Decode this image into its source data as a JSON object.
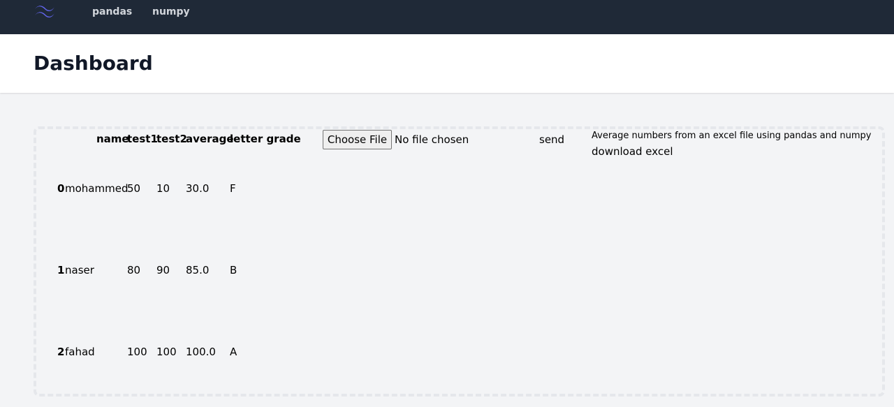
{
  "nav": {
    "logo_icon": "wave-logo-icon",
    "links": [
      "pandas",
      "numpy"
    ]
  },
  "header": {
    "title": "Dashboard"
  },
  "table": {
    "columns": [
      "name",
      "test1",
      "test2",
      "average",
      "letter grade"
    ],
    "rows": [
      {
        "index": "0",
        "name": "mohammed",
        "test1": "50",
        "test2": "10",
        "average": "30.0",
        "grade": "F"
      },
      {
        "index": "1",
        "name": "naser",
        "test1": "80",
        "test2": "90",
        "average": "85.0",
        "grade": "B"
      },
      {
        "index": "2",
        "name": "fahad",
        "test1": "100",
        "test2": "100",
        "average": "100.0",
        "grade": "A"
      }
    ]
  },
  "upload": {
    "choose_label": "Choose File",
    "status": "No file chosen",
    "send_label": "send"
  },
  "info": {
    "description": "Average numbers from an excel file using pandas and numpy",
    "download_label": "download excel"
  },
  "colors": {
    "navbar": "#1f2937",
    "logo": "#6366f1",
    "background": "#f3f4f6"
  }
}
